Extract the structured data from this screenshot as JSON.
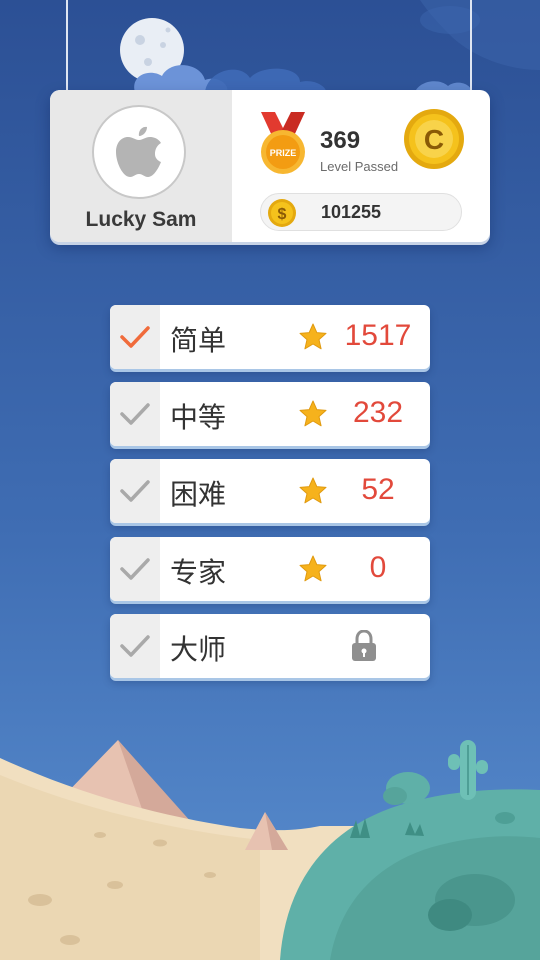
{
  "profile": {
    "name": "Lucky Sam",
    "levels_passed": "369",
    "levels_passed_label": "Level Passed",
    "prize_text": "PRIZE",
    "coin_letter": "C",
    "coins": "101255",
    "coin_symbol": "$"
  },
  "difficulties": [
    {
      "label": "简单",
      "stars": "1517",
      "selected": true,
      "locked": false
    },
    {
      "label": "中等",
      "stars": "232",
      "selected": false,
      "locked": false
    },
    {
      "label": "困难",
      "stars": "52",
      "selected": false,
      "locked": false
    },
    {
      "label": "专家",
      "stars": "0",
      "selected": false,
      "locked": false
    },
    {
      "label": "大师",
      "stars": null,
      "selected": false,
      "locked": true
    }
  ],
  "colors": {
    "sky_top": "#2c5095",
    "sky_bottom": "#5a8fd0",
    "star": "#f6b21c",
    "star_count": "#e2493b",
    "check_selected": "#f06b3b",
    "check_unselected": "#a9a9a9",
    "coin": "#f5c21c",
    "medal_ribbon": "#e23a2f",
    "grass": "#5fb0a8",
    "sand": "#f1dfc0"
  }
}
